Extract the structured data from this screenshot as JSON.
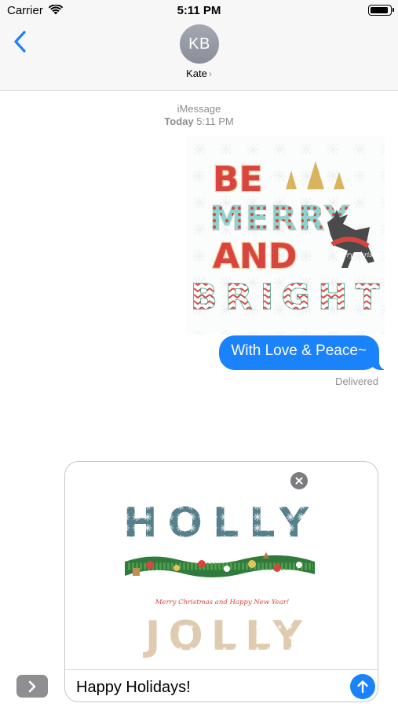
{
  "status_bar": {
    "carrier": "Carrier",
    "time": "5:11 PM",
    "icons": [
      "wifi-icon",
      "battery-icon"
    ]
  },
  "nav": {
    "back_icon": "chevron-left-icon",
    "avatar_initials": "KB",
    "contact_name": "Kate",
    "contact_chevron": "›"
  },
  "thread": {
    "service": "iMessage",
    "day": "Today",
    "time": "5:11 PM"
  },
  "messages": [
    {
      "type": "sticker",
      "sticker_text": [
        "BE",
        "MERRY",
        "AND",
        "BRIGHT"
      ],
      "badge": "Merry Christmas"
    },
    {
      "type": "text",
      "text": "With Love & Peace~",
      "status": "Delivered"
    }
  ],
  "compose": {
    "sticker_text": [
      "HOLLY",
      "JOLLY"
    ],
    "sticker_caption": "Merry Christmas and Happy New Year!",
    "input_value": "Happy Holidays!",
    "remove_icon": "close-icon",
    "send_icon": "arrow-up-icon"
  },
  "toolbar": {
    "apps_icon": "chevron-right-icon"
  },
  "colors": {
    "accent": "#1A82FB",
    "bar_bg": "#F7F7F7",
    "secondary_text": "#8E8E93",
    "avatar": "#9A9EA8"
  }
}
